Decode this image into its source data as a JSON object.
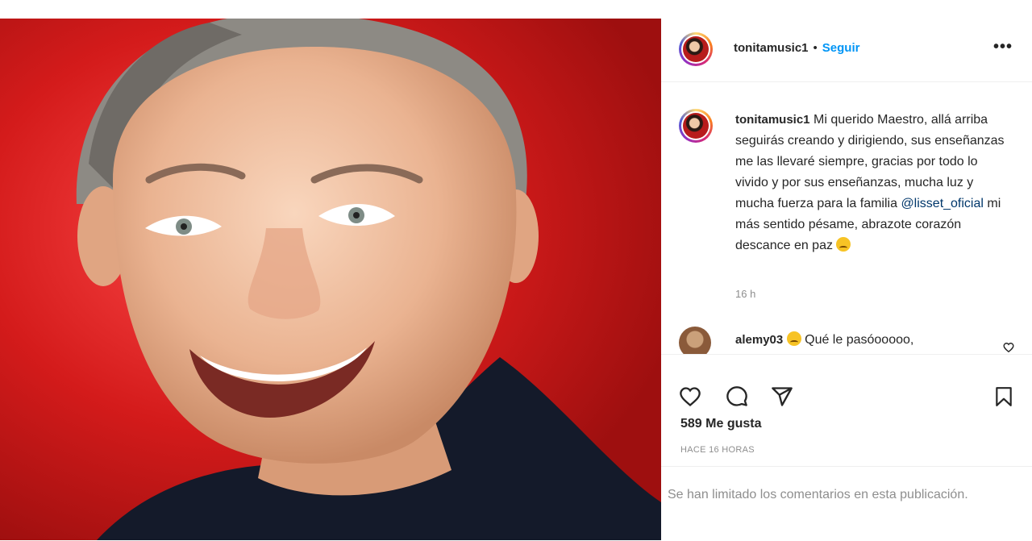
{
  "post": {
    "username": "tonitamusic1",
    "separator": "•",
    "follow_label": "Seguir",
    "more_label": "•••",
    "caption_user": "tonitamusic1",
    "caption_part1": "Mi querido Maestro, allá arriba seguirás creando y dirigiendo, sus enseñanzas me las llevaré siempre, gracias por todo lo vivido y por sus enseñanzas, mucha luz y mucha fuerza para la familia ",
    "caption_mention": "@lisset_oficial",
    "caption_part2": " mi más sentido pésame, abrazote corazón descance en paz ",
    "caption_time": "16 h",
    "likes": "589 Me gusta",
    "time_ago": "HACE 16 HORAS",
    "comments_limited": "Se han limitado los comentarios en esta publicación."
  },
  "comment": {
    "username": "alemy03",
    "text": " Qué le pasóooooo,"
  },
  "icons": {
    "like": "heart-icon",
    "comment": "comment-icon",
    "share": "share-icon",
    "save": "bookmark-icon",
    "emoji": "sad-face-emoji"
  },
  "colors": {
    "accent": "#0095f6",
    "mention": "#00376b",
    "muted": "#8e8e8e",
    "photo_background": "#d41b1b"
  }
}
